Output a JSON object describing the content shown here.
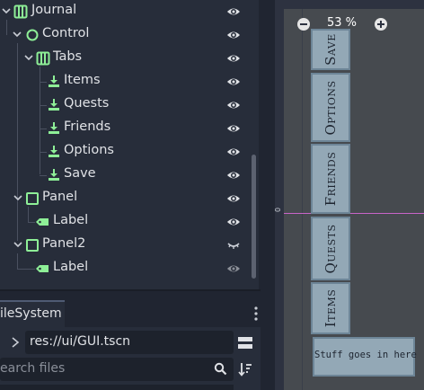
{
  "scene_tree": {
    "nodes": [
      {
        "label": "Journal",
        "icon": "tabs-container-icon"
      },
      {
        "label": "Control",
        "icon": "control-node-icon"
      },
      {
        "label": "Tabs",
        "icon": "tabs-container-icon"
      },
      {
        "label": "Items",
        "icon": "instanced-scene-icon"
      },
      {
        "label": "Quests",
        "icon": "instanced-scene-icon"
      },
      {
        "label": "Friends",
        "icon": "instanced-scene-icon"
      },
      {
        "label": "Options",
        "icon": "instanced-scene-icon"
      },
      {
        "label": "Save",
        "icon": "instanced-scene-icon"
      },
      {
        "label": "Panel",
        "icon": "panel-node-icon"
      },
      {
        "label": "Label",
        "icon": "label-node-icon"
      },
      {
        "label": "Panel2",
        "icon": "panel-node-icon"
      },
      {
        "label": "Label",
        "icon": "label-node-icon"
      }
    ]
  },
  "filesystem": {
    "tab_label": "ileSystem",
    "path": "res://ui/GUI.tscn",
    "search_placeholder": "earch files"
  },
  "viewport": {
    "zoom_label": "53 %",
    "ruler_zero": "0",
    "tabs": [
      "Save",
      "Options",
      "Friends",
      "Quests",
      "Items"
    ],
    "panel_text": "Stuff goes in here"
  },
  "colors": {
    "green_icon": "#8eef97",
    "guide_line": "#c764c7",
    "ui_button": "#93a8b6"
  }
}
